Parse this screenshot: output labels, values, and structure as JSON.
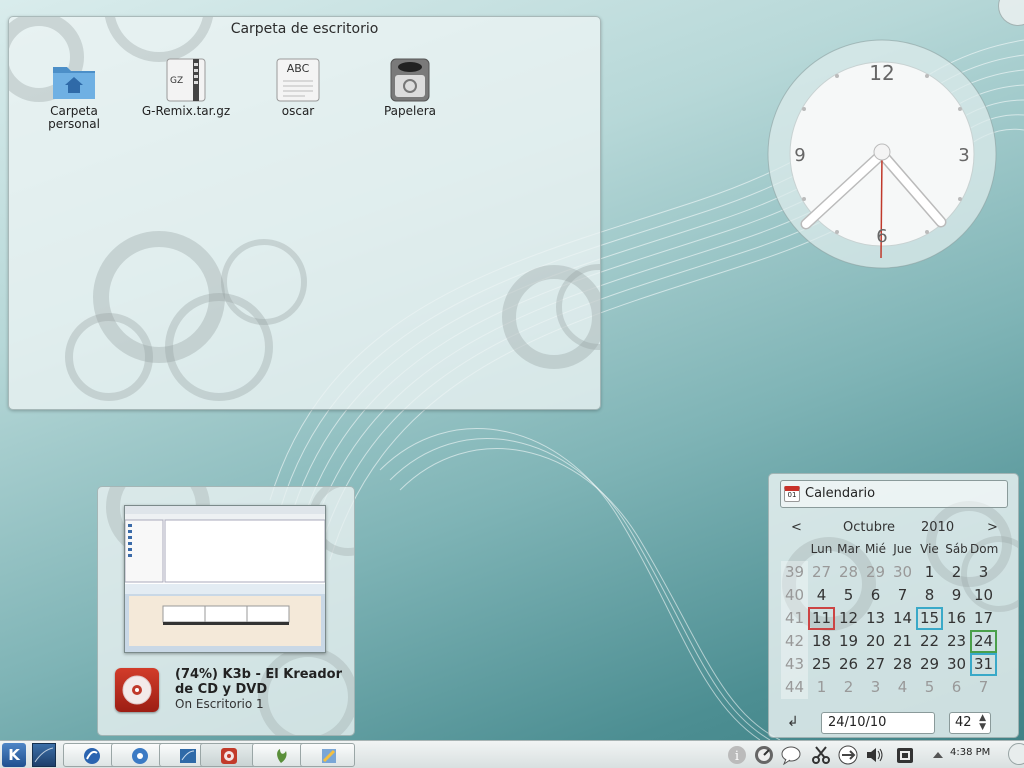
{
  "folderview": {
    "title": "Carpeta de escritorio",
    "icons": [
      {
        "label": "Carpeta personal",
        "icon": "home-folder-icon"
      },
      {
        "label": "G-Remix.tar.gz",
        "icon": "gz-archive-icon",
        "badge": "GZ"
      },
      {
        "label": "oscar",
        "icon": "text-file-icon",
        "badge": "ABC"
      },
      {
        "label": "Papelera",
        "icon": "trash-icon"
      }
    ]
  },
  "clock": {
    "numerals": [
      "12",
      "3",
      "6",
      "9"
    ],
    "time": "4:38"
  },
  "preview": {
    "title": "(74%) K3b - El Kreador de CD y DVD",
    "subtitle": "On Escritorio 1"
  },
  "calendar": {
    "title": "Calendario",
    "header_icon_text": "01",
    "prev": "<",
    "next": ">",
    "month": "Octubre",
    "year": "2010",
    "days_of_week": [
      "Lun",
      "Mar",
      "Mié",
      "Jue",
      "Vie",
      "Sáb",
      "Dom"
    ],
    "weeks": [
      {
        "week": "39",
        "days": [
          "27",
          "28",
          "29",
          "30",
          "1",
          "2",
          "3"
        ]
      },
      {
        "week": "40",
        "days": [
          "4",
          "5",
          "6",
          "7",
          "8",
          "9",
          "10"
        ]
      },
      {
        "week": "41",
        "days": [
          "11",
          "12",
          "13",
          "14",
          "15",
          "16",
          "17"
        ]
      },
      {
        "week": "42",
        "days": [
          "18",
          "19",
          "20",
          "21",
          "22",
          "23",
          "24"
        ]
      },
      {
        "week": "43",
        "days": [
          "25",
          "26",
          "27",
          "28",
          "29",
          "30",
          "31"
        ]
      },
      {
        "week": "44",
        "days": [
          "1",
          "2",
          "3",
          "4",
          "5",
          "6",
          "7"
        ]
      }
    ],
    "today_button": "↲",
    "date_value": "24/10/10",
    "week_value": "42"
  },
  "panel": {
    "kmenu_label": "K",
    "clock": "4:38 PM"
  },
  "colors": {
    "today": "#cc4444",
    "highlight": "#39a9c8",
    "holiday": "#4aa04a"
  }
}
